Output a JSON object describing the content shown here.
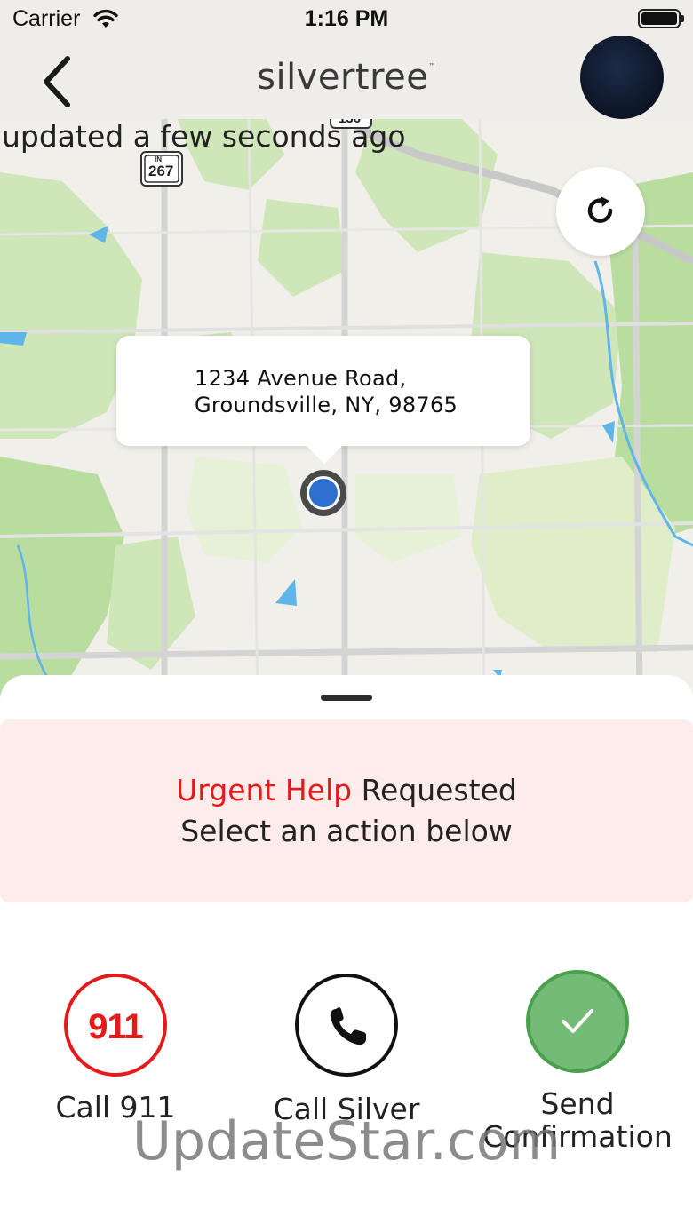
{
  "status_bar": {
    "carrier": "Carrier",
    "time": "1:16 PM",
    "wifi_icon": "wifi-icon",
    "battery_icon": "battery-full-icon"
  },
  "nav": {
    "back_icon": "chevron-left-icon",
    "logo_text": "silvertree",
    "logo_tm": "™",
    "avatar": "avatar"
  },
  "map": {
    "updated_text": "updated a few seconds ago",
    "refresh_icon": "refresh-icon",
    "route_shield_top": "IN",
    "route_shield_number": "267",
    "route_shield_partial": "136",
    "address_line1": "1234 Avenue Road,",
    "address_line2": "Groundsville, NY, 98765",
    "pin_icon": "location-pin-icon",
    "colors": {
      "land": "#f1efe9",
      "park": "#cfe6b8",
      "park_dark": "#b9dc9f",
      "road": "#d8d8d8",
      "water": "#5fb4e8",
      "pin": "#2f6fce"
    }
  },
  "alert": {
    "urgent_word": "Urgent Help",
    "requested_word": " Requested",
    "subtitle": "Select an action below",
    "colors": {
      "urgent": "#e31b1b",
      "background": "#fdeceb"
    }
  },
  "actions": [
    {
      "label": "Call 911",
      "badge": "911",
      "icon": "call-911-icon"
    },
    {
      "label": "Call Silver",
      "icon": "phone-icon"
    },
    {
      "label_line1": "Send",
      "label_line2": "Confirmation",
      "icon": "checkmark-icon"
    }
  ],
  "watermark": "UpdateStar.com"
}
